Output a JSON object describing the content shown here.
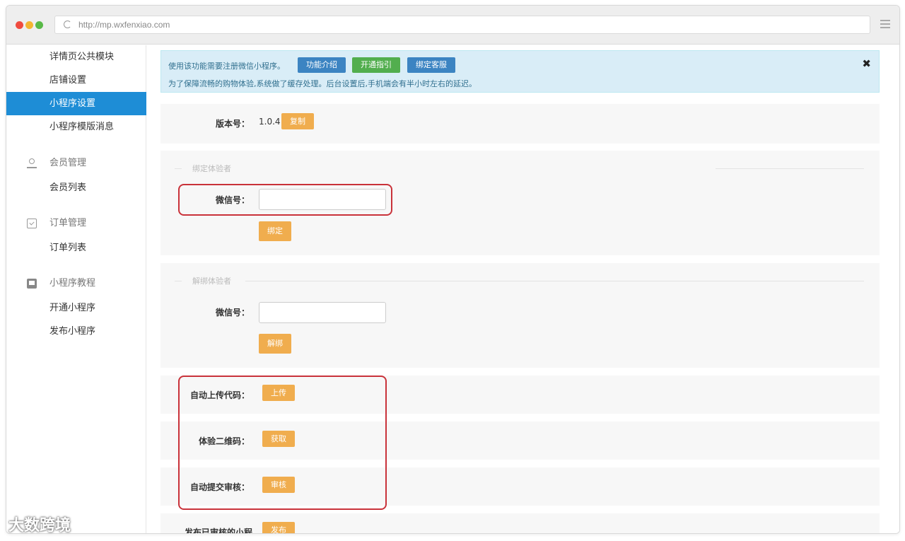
{
  "browser": {
    "url": "http://mp.wxfenxiao.com"
  },
  "sidebar": {
    "items": [
      {
        "label": "详情页公共模块"
      },
      {
        "label": "店铺设置"
      },
      {
        "label": "小程序设置"
      },
      {
        "label": "小程序模版消息"
      }
    ],
    "groups": [
      {
        "label": "会员管理",
        "icon": "user-icon",
        "items": [
          {
            "label": "会员列表"
          }
        ]
      },
      {
        "label": "订单管理",
        "icon": "clipboard-icon",
        "items": [
          {
            "label": "订单列表"
          }
        ]
      },
      {
        "label": "小程序教程",
        "icon": "image-icon",
        "items": [
          {
            "label": "开通小程序"
          },
          {
            "label": "发布小程序"
          }
        ]
      }
    ],
    "active_color": "#1e8dd6"
  },
  "notice": {
    "line1": "使用该功能需要注册微信小程序。",
    "line2": "为了保障流畅的购物体验,系统做了缓存处理。后台设置后,手机端会有半小时左右的延迟。",
    "btn_intro": "功能介绍",
    "btn_guide": "开通指引",
    "btn_service": "绑定客服",
    "close": "✖"
  },
  "version": {
    "label": "版本号：",
    "value": "1.0.4",
    "copy_btn": "复制"
  },
  "bind": {
    "legend": "绑定体验者",
    "wechat_label": "微信号：",
    "wechat_value": "",
    "button": "绑定"
  },
  "unbind": {
    "legend": "解绑体验者",
    "wechat_label": "微信号：",
    "wechat_value": "",
    "button": "解绑"
  },
  "actions": {
    "upload_label": "自动上传代码：",
    "upload_btn": "上传",
    "qrcode_label": "体验二维码：",
    "qrcode_btn": "获取",
    "audit_label": "自动提交审核：",
    "audit_btn": "审核",
    "publish_label": "发布已审核的小程",
    "publish_btn": "发布"
  },
  "watermark": "大数跨境",
  "colors": {
    "orange_button": "#f0ad4e",
    "highlight_box": "#c9323a",
    "notice_bg": "#d9edf7"
  }
}
